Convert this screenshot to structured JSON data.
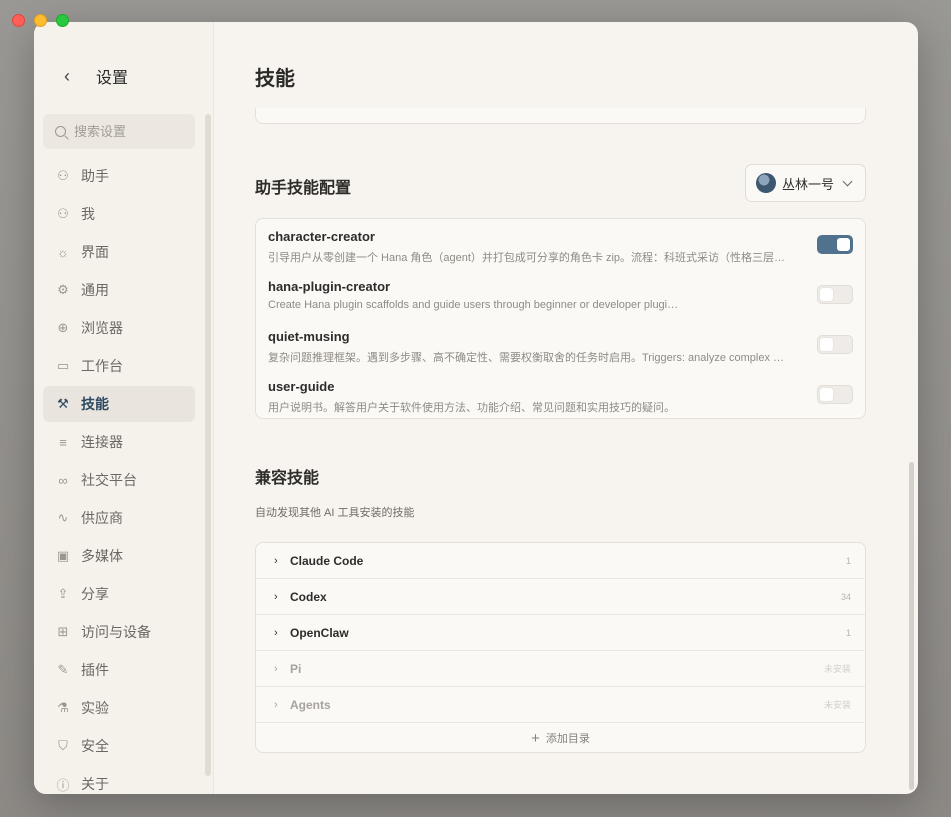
{
  "window": {
    "sidebar": {
      "title": "设置",
      "search_placeholder": "搜索设置",
      "items": [
        {
          "label": "助手",
          "icon": "person-icon"
        },
        {
          "label": "我",
          "icon": "user-icon"
        },
        {
          "label": "界面",
          "icon": "sun-icon"
        },
        {
          "label": "通用",
          "icon": "gear-icon"
        },
        {
          "label": "浏览器",
          "icon": "globe-icon"
        },
        {
          "label": "工作台",
          "icon": "briefcase-icon"
        },
        {
          "label": "技能",
          "icon": "wrench-icon",
          "active": true
        },
        {
          "label": "连接器",
          "icon": "sliders-icon"
        },
        {
          "label": "社交平台",
          "icon": "link-icon"
        },
        {
          "label": "供应商",
          "icon": "activity-icon"
        },
        {
          "label": "多媒体",
          "icon": "image-icon"
        },
        {
          "label": "分享",
          "icon": "share-icon"
        },
        {
          "label": "访问与设备",
          "icon": "device-icon"
        },
        {
          "label": "插件",
          "icon": "feather-icon"
        },
        {
          "label": "实验",
          "icon": "flask-icon"
        },
        {
          "label": "安全",
          "icon": "shield-icon"
        },
        {
          "label": "关于",
          "icon": "info-icon"
        }
      ]
    },
    "main": {
      "title": "技能",
      "assistant_section": {
        "title": "助手技能配置",
        "agent_select": "丛林一号",
        "skills": [
          {
            "name": "character-creator",
            "desc": "引导用户从零创建一个 Hana 角色（agent）并打包成可分享的角色卡 zip。流程：科班式采访（性格三层…",
            "enabled": true
          },
          {
            "name": "hana-plugin-creator",
            "desc": "Create Hana plugin scaffolds and guide users through beginner or developer plugi…",
            "enabled": false
          },
          {
            "name": "quiet-musing",
            "desc": "复杂问题推理框架。遇到多步骤、高不确定性、需要权衡取舍的任务时启用。Triggers: analyze complex …",
            "enabled": false
          },
          {
            "name": "user-guide",
            "desc": "用户说明书。解答用户关于软件使用方法、功能介绍、常见问题和实用技巧的疑问。",
            "enabled": false
          }
        ]
      },
      "compat_section": {
        "title": "兼容技能",
        "desc": "自动发现其他 AI 工具安装的技能",
        "sources": [
          {
            "name": "Claude Code",
            "count": "1",
            "installed": true
          },
          {
            "name": "Codex",
            "count": "34",
            "installed": true
          },
          {
            "name": "OpenClaw",
            "count": "1",
            "installed": true
          },
          {
            "name": "Pi",
            "count": "未安装",
            "installed": false
          },
          {
            "name": "Agents",
            "count": "未安装",
            "installed": false
          }
        ],
        "add_dir_label": "添加目录"
      }
    }
  }
}
